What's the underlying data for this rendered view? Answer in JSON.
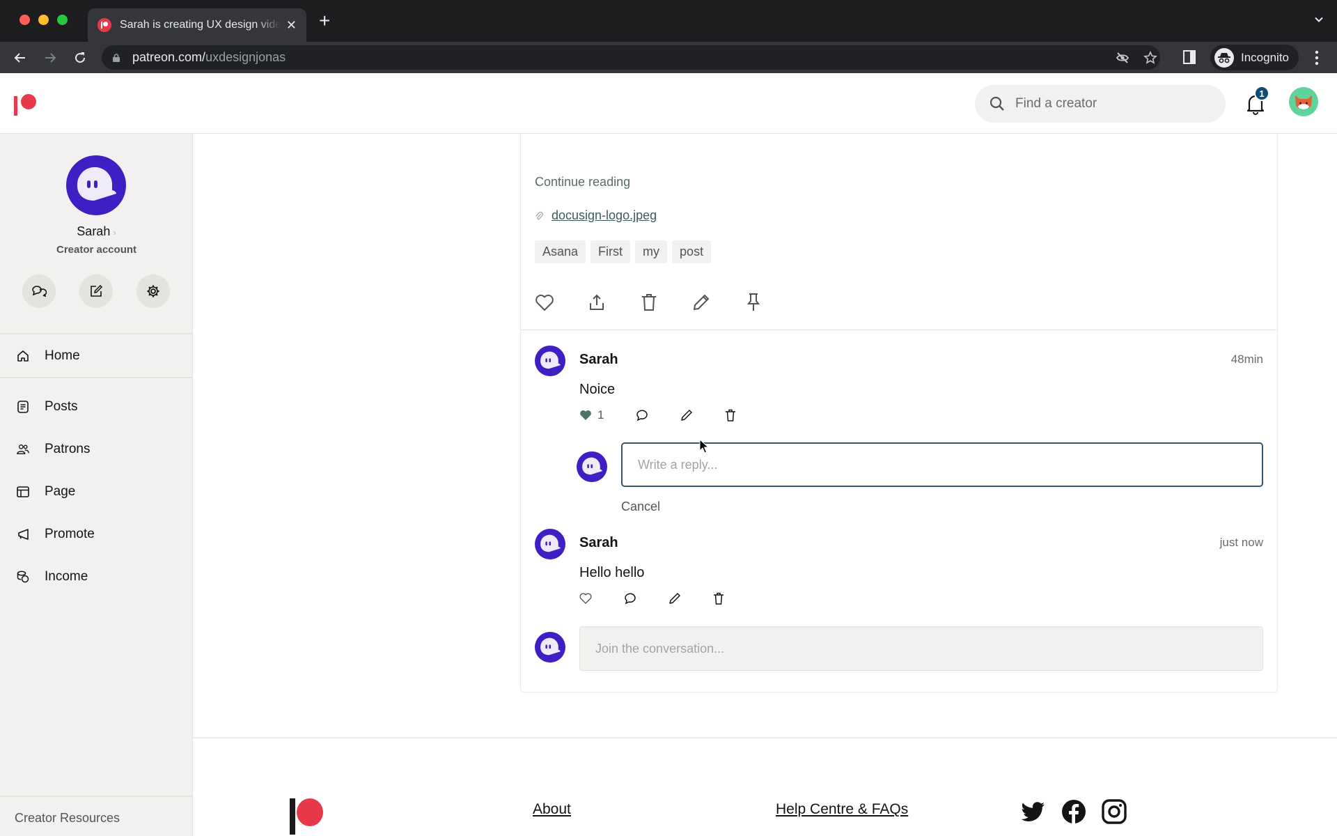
{
  "browser": {
    "tab_title": "Sarah is creating UX design videos",
    "url_host": "patreon.com/",
    "url_path": "uxdesignjonas",
    "profile_label": "Incognito"
  },
  "header": {
    "search_placeholder": "Find a creator",
    "notification_count": "1"
  },
  "sidebar": {
    "name": "Sarah",
    "name_chevron": "›",
    "role": "Creator account",
    "actions": [
      "messages",
      "create-post",
      "settings"
    ],
    "nav": [
      {
        "label": "Home",
        "icon": "home-icon"
      },
      {
        "label": "Posts",
        "icon": "posts-icon"
      },
      {
        "label": "Patrons",
        "icon": "patrons-icon"
      },
      {
        "label": "Page",
        "icon": "page-icon"
      },
      {
        "label": "Promote",
        "icon": "megaphone-icon"
      },
      {
        "label": "Income",
        "icon": "coins-icon"
      }
    ],
    "footer_label": "Creator Resources"
  },
  "post": {
    "continue_label": "Continue reading",
    "attachment": "docusign-logo.jpeg",
    "tags": [
      "Asana",
      "First",
      "my",
      "post"
    ],
    "actions": [
      "like",
      "share",
      "delete",
      "edit",
      "pin"
    ]
  },
  "comments": [
    {
      "author": "Sarah",
      "time": "48min",
      "body": "Noice",
      "likes": "1",
      "liked": true
    },
    {
      "author": "Sarah",
      "time": "just now",
      "body": "Hello hello",
      "likes": "",
      "liked": false
    }
  ],
  "reply": {
    "placeholder": "Write a reply...",
    "cancel_label": "Cancel"
  },
  "join": {
    "placeholder": "Join the conversation..."
  },
  "footer": {
    "links": [
      "About",
      "Help Centre & FAQs"
    ],
    "social": [
      "twitter",
      "facebook",
      "instagram"
    ]
  },
  "colors": {
    "brand": "#e8394b",
    "avatar_purple": "#3f1fc4",
    "liked_heart": "#4d7566",
    "focus_border": "#35576e"
  }
}
